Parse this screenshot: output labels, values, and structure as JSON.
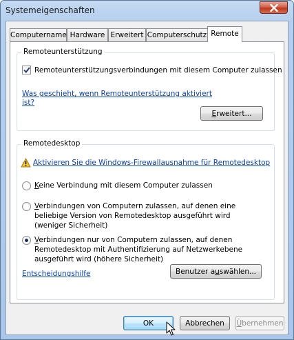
{
  "window": {
    "title": "Systemeigenschaften"
  },
  "tabs": [
    {
      "label": "Computername"
    },
    {
      "label": "Hardware"
    },
    {
      "label": "Erweitert"
    },
    {
      "label": "Computerschutz"
    },
    {
      "label": "Remote",
      "active": true
    }
  ],
  "remote_assistance": {
    "group_title": "Remoteunterstützung",
    "checkbox_label": "Remoteunterstützungsverbindungen mit diesem Computer zulassen",
    "checked": true,
    "help_link_line1": "Was geschieht, wenn Remoteunterstützung aktiviert",
    "help_link_line2": "ist?",
    "advanced_button_pre": "",
    "advanced_button_ul": "E",
    "advanced_button_post": "rweitert..."
  },
  "remote_desktop": {
    "group_title": "Remotedesktop",
    "firewall_link": "Aktivieren Sie die Windows-Firewallausnahme für Remotedesktop",
    "options": [
      {
        "ul": "K",
        "rest": "eine Verbindung mit diesem Computer zulassen",
        "selected": false
      },
      {
        "ul": "V",
        "rest": "erbindungen von Computern zulassen, auf denen eine beliebige Version von Remotedesktop ausgeführt wird (weniger Sicherheit)",
        "selected": false
      },
      {
        "ul": "V",
        "rest": "erbindungen nur von Computern zulassen, auf denen Remotedesktop mit Authentifizierung auf Netzwerkebene ausgeführt wird (höhere Sicherheit)",
        "selected": true
      }
    ],
    "help_link": "Entscheidungshilfe",
    "select_users_pre": "Benutzer a",
    "select_users_ul": "u",
    "select_users_post": "swählen..."
  },
  "footer": {
    "ok": "OK",
    "cancel": "Abbrechen",
    "apply_pre": "Ü",
    "apply_post": "bernehmen"
  },
  "icons": {
    "close": "close-icon",
    "warning": "warning-icon",
    "cursor": "mouse-pointer-icon"
  }
}
